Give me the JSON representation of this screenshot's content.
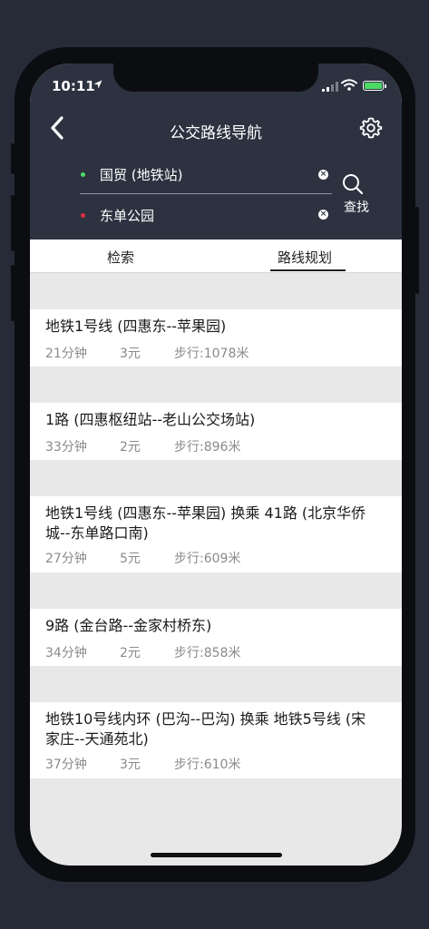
{
  "status_bar": {
    "time": "10:11"
  },
  "header": {
    "title": "公交路线导航"
  },
  "search": {
    "from": "国贸 (地铁站)",
    "to": "东单公园",
    "button_label": "查找"
  },
  "tabs": [
    {
      "label": "检索",
      "active": false
    },
    {
      "label": "路线规划",
      "active": true
    }
  ],
  "routes": [
    {
      "name": "地铁1号线 (四惠东--苹果园)",
      "duration": "21分钟",
      "fare": "3元",
      "walk": "步行:1078米"
    },
    {
      "name": "1路 (四惠枢纽站--老山公交场站)",
      "duration": "33分钟",
      "fare": "2元",
      "walk": "步行:896米"
    },
    {
      "name": "地铁1号线 (四惠东--苹果园) 换乘 41路 (北京华侨城--东单路口南)",
      "duration": "27分钟",
      "fare": "5元",
      "walk": "步行:609米"
    },
    {
      "name": "9路 (金台路--金家村桥东)",
      "duration": "34分钟",
      "fare": "2元",
      "walk": "步行:858米"
    },
    {
      "name": "地铁10号线内环 (巴沟--巴沟) 换乘 地铁5号线 (宋家庄--天通苑北)",
      "duration": "37分钟",
      "fare": "3元",
      "walk": "步行:610米"
    }
  ],
  "colors": {
    "header_bg": "#2c3240",
    "from_dot": "#4cd964",
    "to_dot": "#e0303a",
    "list_bg": "#e8e8e8"
  },
  "icons": [
    "back-arrow-icon",
    "gear-icon",
    "search-icon",
    "clear-icon",
    "location-arrow-icon",
    "signal-icon",
    "wifi-icon",
    "battery-icon"
  ]
}
